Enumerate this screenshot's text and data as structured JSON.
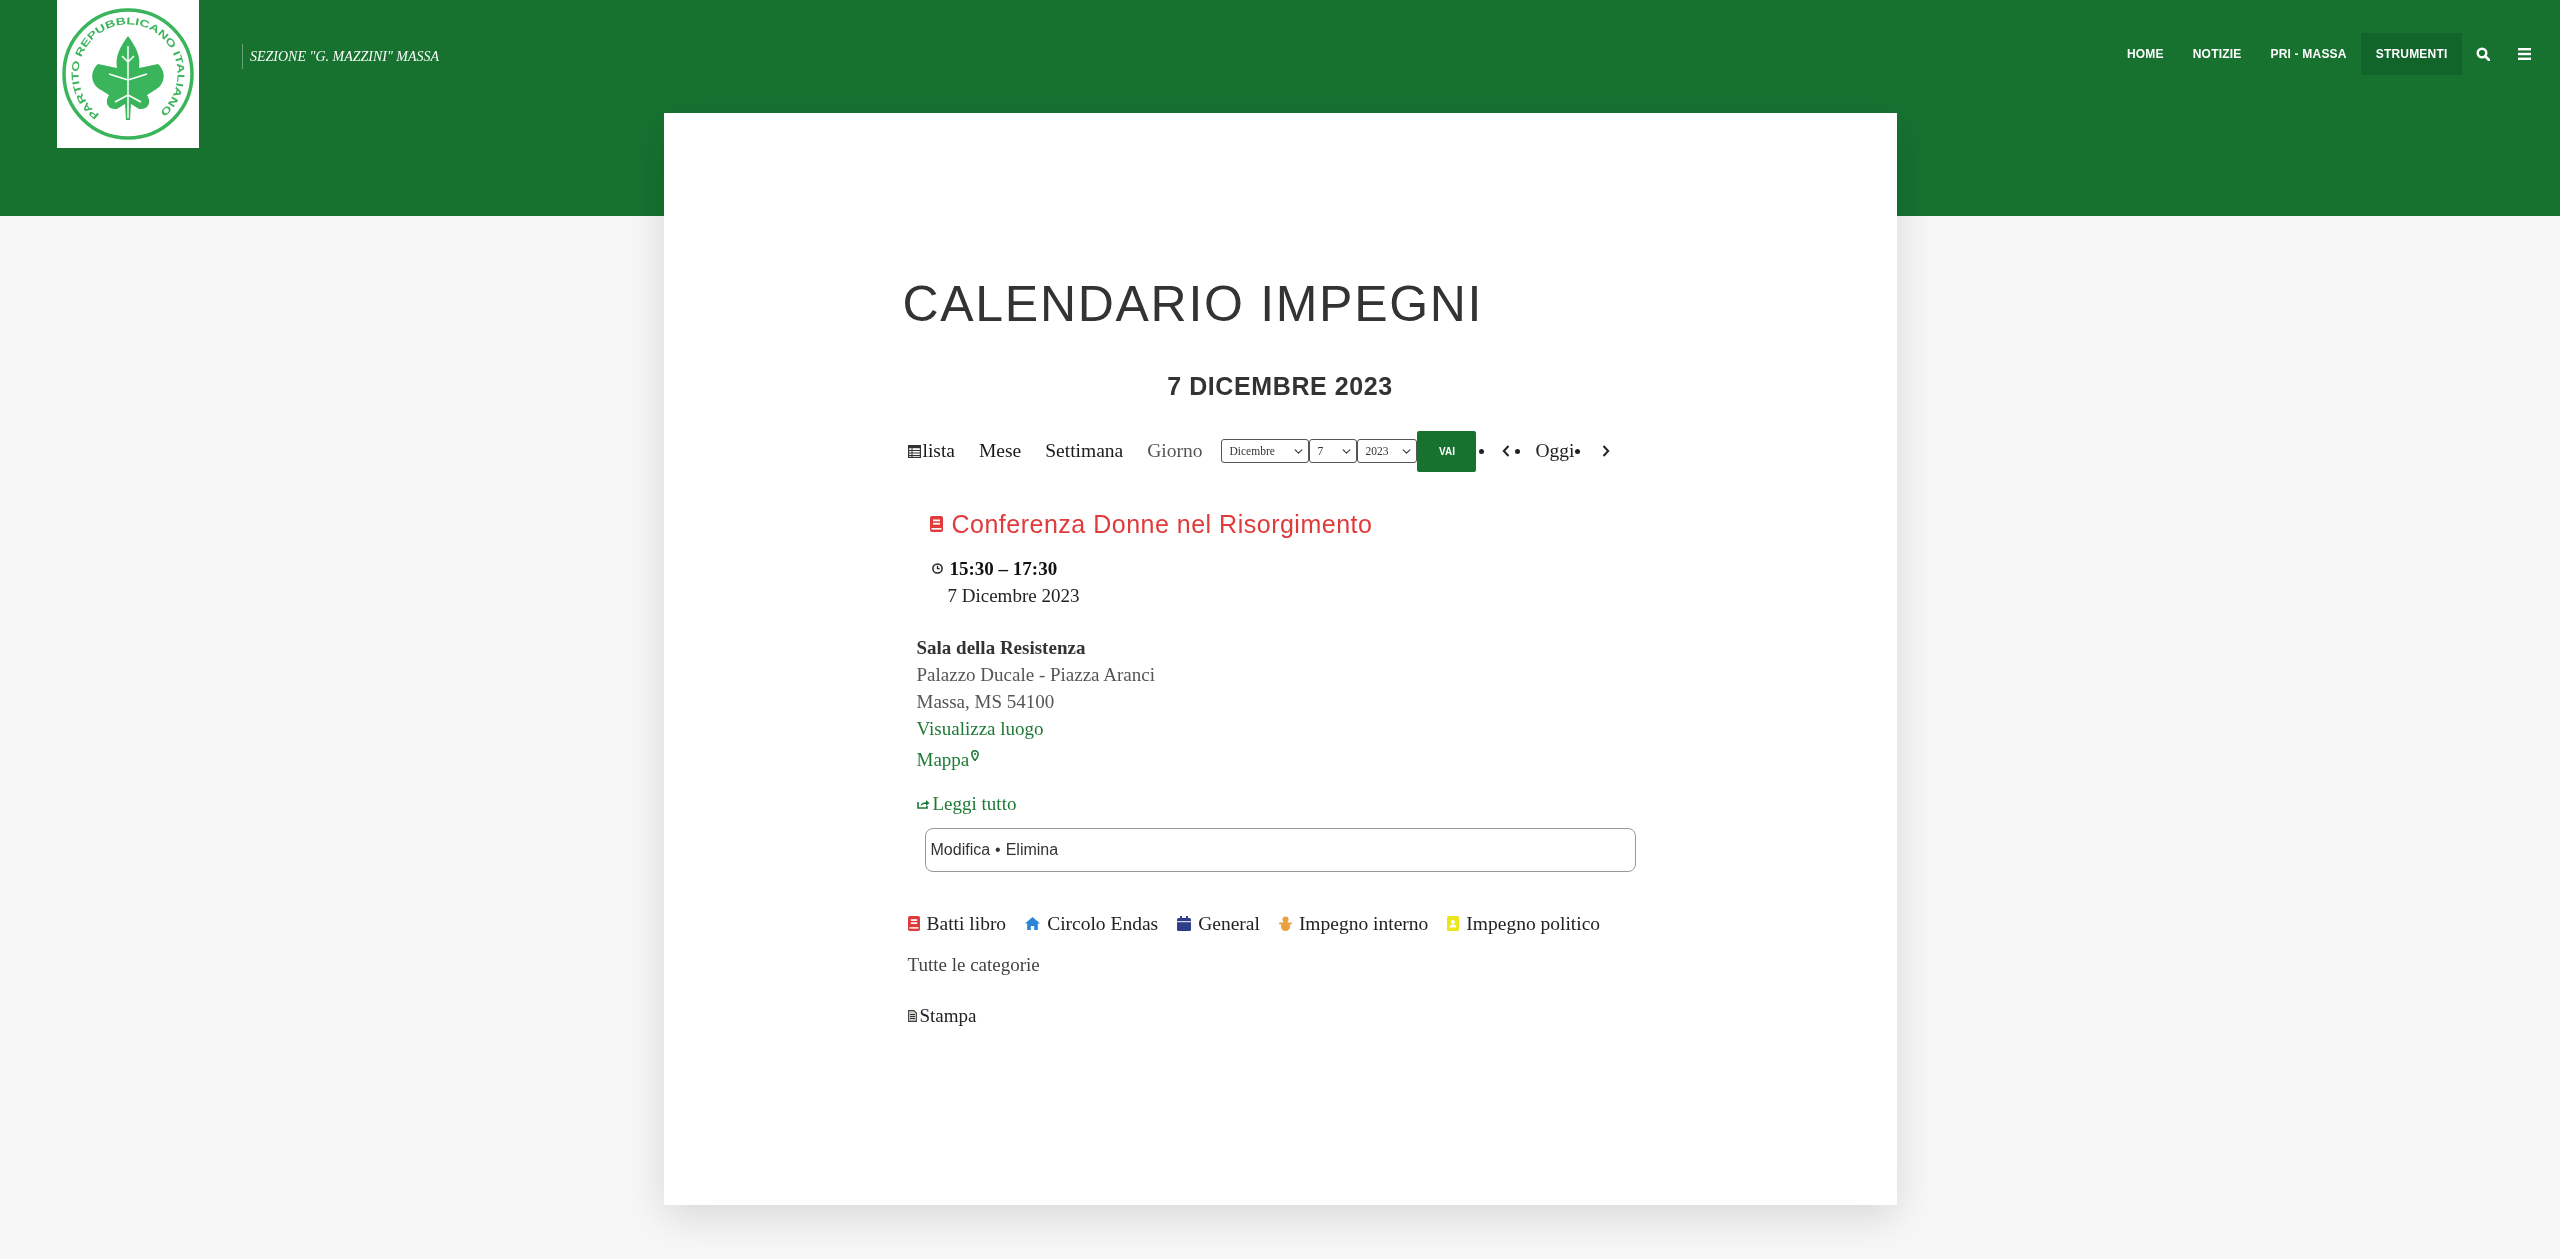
{
  "header": {
    "logo_text": "PARTITO REPUBBLICANO ITALIANO",
    "site_title": "SEZIONE \"G. MAZZINI\" MASSA",
    "nav": [
      {
        "label": "HOME",
        "selected": false
      },
      {
        "label": "NOTIZIE",
        "selected": false
      },
      {
        "label": "PRI - MASSA",
        "selected": false
      },
      {
        "label": "STRUMENTI",
        "selected": true
      }
    ]
  },
  "page": {
    "title": "CALENDARIO IMPEGNI"
  },
  "calendar": {
    "heading": "7 DICEMBRE 2023",
    "views": [
      {
        "label": "lista",
        "kind": "list",
        "selected": false
      },
      {
        "label": "Mese",
        "kind": "plain",
        "selected": false
      },
      {
        "label": "Settimana",
        "kind": "plain",
        "selected": false
      },
      {
        "label": "Giorno",
        "kind": "plain",
        "selected": true
      }
    ],
    "date_picker": {
      "month": "Dicembre",
      "day": "7",
      "year": "2023",
      "button": "VAI"
    },
    "pager": {
      "today": "Oggi"
    }
  },
  "event": {
    "title": "Conferenza Donne nel Risorgimento",
    "time": "15:30 – 17:30",
    "date": "7 Dicembre 2023",
    "location": {
      "name": "Sala della Resistenza",
      "address": "Palazzo Ducale - Piazza Aranci",
      "city": "Massa, MS 54100",
      "view_link": "Visualizza luogo",
      "map_link": "Mappa"
    },
    "read_more": "Leggi tutto",
    "admin": {
      "edit": "Modifica",
      "separator": "•",
      "delete": "Elimina"
    }
  },
  "categories": [
    {
      "label": "Batti libro",
      "kind": "book",
      "color": "#e03a3a"
    },
    {
      "label": "Circolo Endas",
      "kind": "home",
      "color": "#2b84d6"
    },
    {
      "label": "General",
      "kind": "calendar",
      "color": "#2c3e8c"
    },
    {
      "label": "Impegno interno",
      "kind": "figure",
      "color": "#e8a03c"
    },
    {
      "label": "Impegno politico",
      "kind": "contact",
      "color": "#ece51c"
    }
  ],
  "all_categories": "Tutte le categorie",
  "print": "Stampa"
}
